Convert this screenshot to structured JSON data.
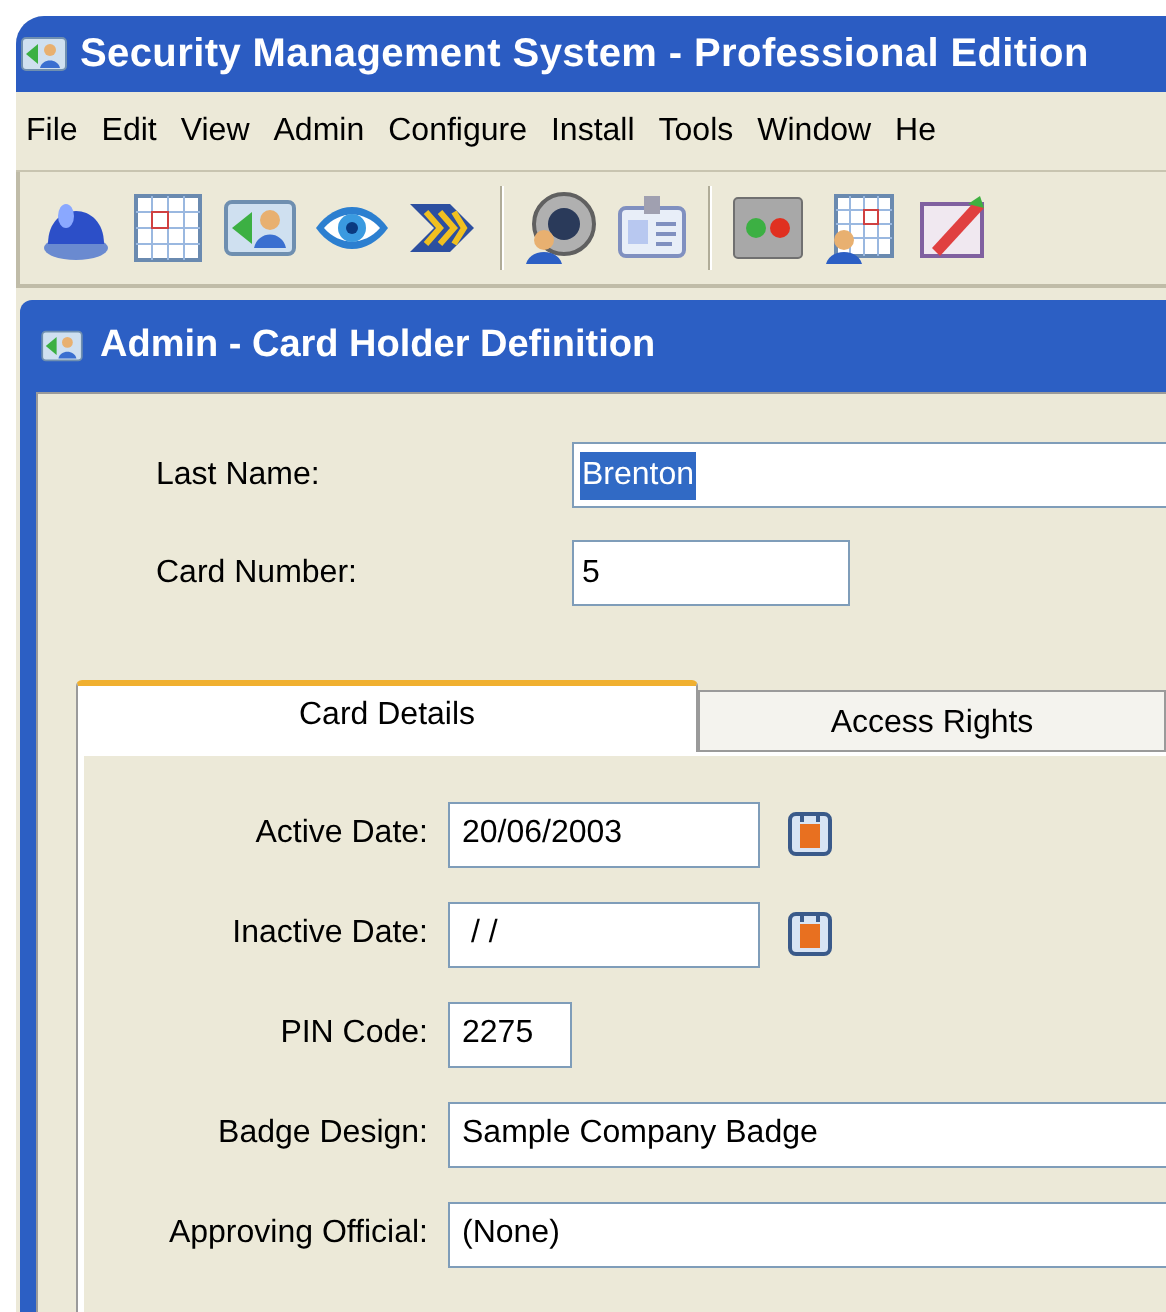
{
  "window": {
    "title": "Security Management System - Professional Edition"
  },
  "menu": [
    "File",
    "Edit",
    "View",
    "Admin",
    "Configure",
    "Install",
    "Tools",
    "Window",
    "He"
  ],
  "toolbar": [
    {
      "kind": "alarm"
    },
    {
      "kind": "grid"
    },
    {
      "kind": "card-user"
    },
    {
      "kind": "eye"
    },
    {
      "kind": "chevrons"
    },
    {
      "kind": "separator"
    },
    {
      "kind": "speaker-user"
    },
    {
      "kind": "badge"
    },
    {
      "kind": "separator"
    },
    {
      "kind": "lights"
    },
    {
      "kind": "grid-user"
    },
    {
      "kind": "edit"
    }
  ],
  "child_window": {
    "title": "Admin - Card Holder Definition"
  },
  "fields": [
    {
      "label": "Last Name:",
      "value": "Brenton",
      "text_selected": true,
      "kind": "wide"
    },
    {
      "label": "Card Number:",
      "value": "5",
      "text_selected": false,
      "kind": "medium"
    }
  ],
  "tabs": [
    {
      "label": "Card Details",
      "selected": true
    },
    {
      "label": "Access Rights",
      "selected": false
    }
  ],
  "details": [
    {
      "label": "Active Date:",
      "value": "20/06/2003",
      "kind": "date"
    },
    {
      "label": "Inactive Date:",
      "value": " / /",
      "kind": "date"
    },
    {
      "label": "PIN Code:",
      "value": "2275",
      "kind": "short"
    },
    {
      "label": "Badge Design:",
      "value": "Sample Company Badge",
      "kind": "wide"
    },
    {
      "label": "Approving Official:",
      "value": "(None)",
      "kind": "wide"
    }
  ]
}
